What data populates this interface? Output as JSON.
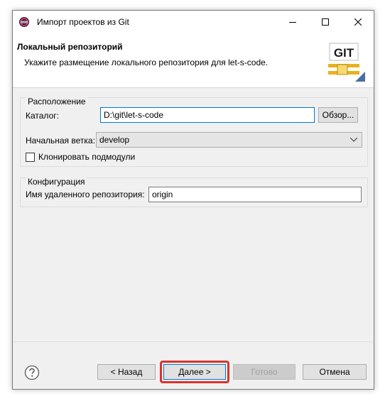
{
  "window": {
    "title": "Импорт проектов из Git",
    "controls": {
      "minimize": "minimize-icon",
      "maximize": "maximize-icon",
      "close": "close-icon"
    }
  },
  "header": {
    "title": "Локальный репозиторий",
    "description": "Укажите размещение локального репозитория для let-s-code.",
    "logo_text": "GIT"
  },
  "location": {
    "group_title": "Расположение",
    "directory_label": "Каталог:",
    "directory_value": "D:\\git\\let-s-code",
    "browse_label": "Обзор...",
    "branch_label": "Начальная ветка:",
    "branch_value": "develop",
    "clone_submodules_label": "Клонировать подмодули",
    "clone_submodules_checked": false
  },
  "configuration": {
    "group_title": "Конфигурация",
    "remote_name_label": "Имя удаленного репозитория:",
    "remote_name_value": "origin"
  },
  "footer": {
    "back_label": "< Назад",
    "next_label": "Далее >",
    "finish_label": "Готово",
    "cancel_label": "Отмена"
  },
  "colors": {
    "highlight": "#d9342b",
    "focus": "#0078d7",
    "window_bg": "#f0f0f0"
  }
}
